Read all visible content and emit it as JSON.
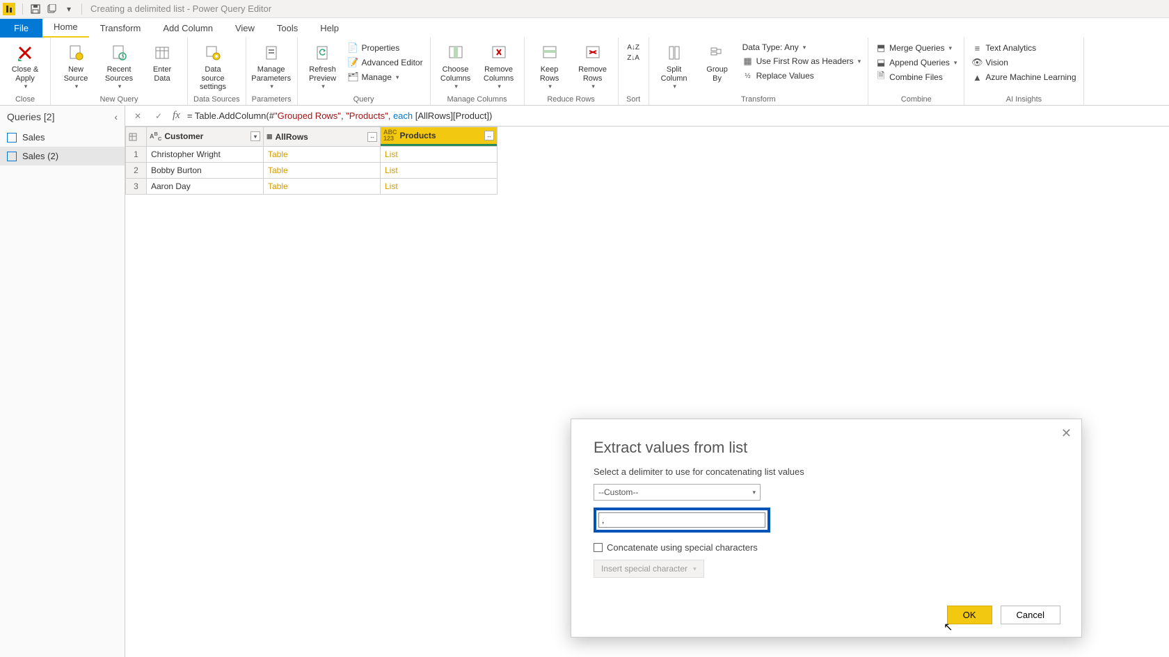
{
  "titlebar": {
    "app_glyph": "⬍",
    "title": "Creating a delimited list - Power Query Editor"
  },
  "tabs": {
    "file": "File",
    "home": "Home",
    "transform": "Transform",
    "add_column": "Add Column",
    "view": "View",
    "tools": "Tools",
    "help": "Help"
  },
  "ribbon": {
    "close": {
      "close_apply": "Close &\nApply",
      "group": "Close"
    },
    "new_query": {
      "new_source": "New\nSource",
      "recent_sources": "Recent\nSources",
      "enter_data": "Enter\nData",
      "group": "New Query"
    },
    "data_sources": {
      "data_source_settings": "Data source\nsettings",
      "group": "Data Sources"
    },
    "parameters": {
      "manage_parameters": "Manage\nParameters",
      "group": "Parameters"
    },
    "query": {
      "refresh_preview": "Refresh\nPreview",
      "properties": "Properties",
      "advanced_editor": "Advanced Editor",
      "manage": "Manage",
      "group": "Query"
    },
    "manage_cols": {
      "choose": "Choose\nColumns",
      "remove": "Remove\nColumns",
      "group": "Manage Columns"
    },
    "reduce_rows": {
      "keep": "Keep\nRows",
      "remove": "Remove\nRows",
      "group": "Reduce Rows"
    },
    "sort": {
      "group": "Sort"
    },
    "transform": {
      "split": "Split\nColumn",
      "groupby": "Group\nBy",
      "data_type": "Data Type: Any",
      "first_row": "Use First Row as Headers",
      "replace": "Replace Values",
      "group": "Transform"
    },
    "combine": {
      "merge": "Merge Queries",
      "append": "Append Queries",
      "combine_files": "Combine Files",
      "group": "Combine"
    },
    "ai": {
      "text_analytics": "Text Analytics",
      "vision": "Vision",
      "azure_ml": "Azure Machine Learning",
      "group": "AI Insights"
    }
  },
  "queries": {
    "header": "Queries [2]",
    "items": [
      "Sales",
      "Sales (2)"
    ]
  },
  "formula": {
    "prefix": "= Table.AddColumn(#",
    "str1": "\"Grouped Rows\"",
    "mid1": ", ",
    "str2": "\"Products\"",
    "mid2": ", ",
    "kw": "each",
    "suffix": " [AllRows][Product])"
  },
  "grid": {
    "cols": {
      "customer": "Customer",
      "allrows": "AllRows",
      "products": "Products"
    },
    "rows": [
      {
        "n": "1",
        "customer": "Christopher Wright",
        "allrows": "Table",
        "products": "List"
      },
      {
        "n": "2",
        "customer": "Bobby Burton",
        "allrows": "Table",
        "products": "List"
      },
      {
        "n": "3",
        "customer": "Aaron Day",
        "allrows": "Table",
        "products": "List"
      }
    ]
  },
  "dialog": {
    "title": "Extract values from list",
    "sub": "Select a delimiter to use for concatenating list values",
    "select_value": "--Custom--",
    "input_value": ", ",
    "check_label": "Concatenate using special characters",
    "insert_label": "Insert special character",
    "ok": "OK",
    "cancel": "Cancel"
  }
}
